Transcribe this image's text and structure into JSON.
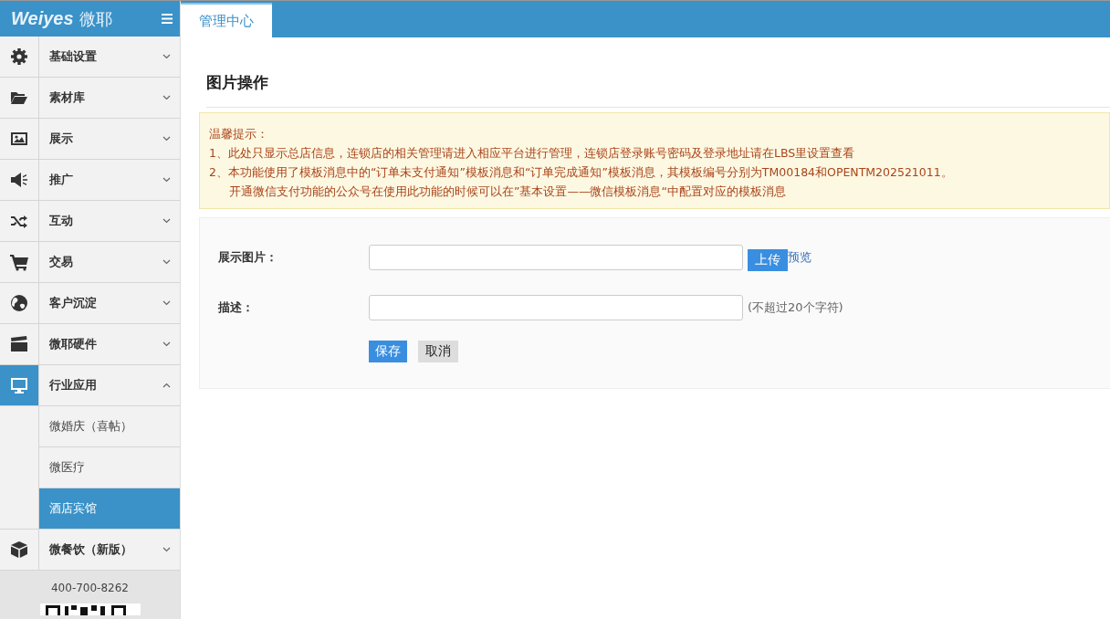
{
  "logo": {
    "brand": "Weiyes",
    "name": "微耶"
  },
  "sidebar": {
    "items": [
      {
        "label": "基础设置",
        "expanded": false,
        "selected": false
      },
      {
        "label": "素材库",
        "expanded": false,
        "selected": false
      },
      {
        "label": "展示",
        "expanded": false,
        "selected": false
      },
      {
        "label": "推广",
        "expanded": false,
        "selected": false
      },
      {
        "label": "互动",
        "expanded": false,
        "selected": false
      },
      {
        "label": "交易",
        "expanded": false,
        "selected": false
      },
      {
        "label": "客户沉淀",
        "expanded": false,
        "selected": false
      },
      {
        "label": "微耶硬件",
        "expanded": false,
        "selected": false
      },
      {
        "label": "行业应用",
        "expanded": true,
        "selected": true,
        "children": [
          {
            "label": "微婚庆（喜帖）",
            "selected": false
          },
          {
            "label": "微医疗",
            "selected": false
          },
          {
            "label": "酒店宾馆",
            "selected": true
          }
        ]
      },
      {
        "label": "微餐饮（新版）",
        "expanded": false,
        "selected": false
      }
    ],
    "phone": "400-700-8262"
  },
  "tabs": [
    {
      "label": "管理中心",
      "selected": true
    }
  ],
  "page_title": "图片操作",
  "notice": {
    "title": "温馨提示：",
    "lines": [
      "1、此处只显示总店信息，连锁店的相关管理请进入相应平台进行管理，连锁店登录账号密码及登录地址请在LBS里设置查看",
      "2、本功能使用了模板消息中的“订单未支付通知”模板消息和“订单完成通知”模板消息，其模板编号分别为TM00184和OPENTM202521011。",
      "开通微信支付功能的公众号在使用此功能的时候可以在”基本设置——微信模板消息“中配置对应的模板消息"
    ]
  },
  "form": {
    "fields": [
      {
        "label": "展示图片：",
        "kind": "upload",
        "button": "上传",
        "link": "预览"
      },
      {
        "label": "描述：",
        "kind": "text",
        "hint": "(不超过20个字符)"
      }
    ],
    "save": "保存",
    "cancel": "取消"
  }
}
